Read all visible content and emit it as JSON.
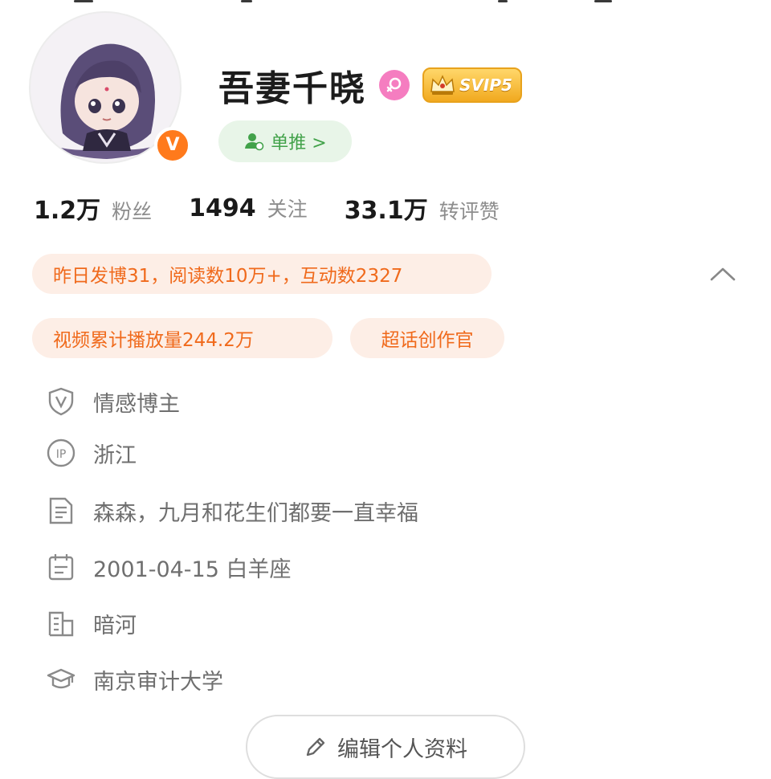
{
  "profile": {
    "username": "吾妻千晓",
    "avatar": "anime-avatar-purple-hair",
    "verified_badge": "V",
    "gender_icon": "female-icon",
    "vip_level": "SVIP5",
    "follow_button": "单推 >"
  },
  "stats": [
    {
      "value": "1.2万",
      "label": "粉丝"
    },
    {
      "value": "1494",
      "label": "关注"
    },
    {
      "value": "33.1万",
      "label": "转评赞"
    }
  ],
  "highlights": {
    "yesterday": "昨日发博31，阅读数10万+，互动数2327",
    "video": "视频累计播放量244.2万",
    "creator": "超话创作官"
  },
  "info": [
    {
      "icon": "verified-shield-icon",
      "text": "情感博主"
    },
    {
      "icon": "ip-location-icon",
      "text": "浙江"
    },
    {
      "icon": "bio-document-icon",
      "text": "森森，九月和花生们都要一直幸福"
    },
    {
      "icon": "calendar-icon",
      "text": "2001-04-15 白羊座"
    },
    {
      "icon": "company-building-icon",
      "text": "暗河"
    },
    {
      "icon": "graduation-cap-icon",
      "text": "南京审计大学"
    }
  ],
  "actions": {
    "edit_profile": "编辑个人资料"
  },
  "colors": {
    "accent_orange": "#f06a1c",
    "pill_bg": "#fdeee6",
    "follow_green": "#42a24a",
    "verified_orange": "#ff7a1c"
  }
}
